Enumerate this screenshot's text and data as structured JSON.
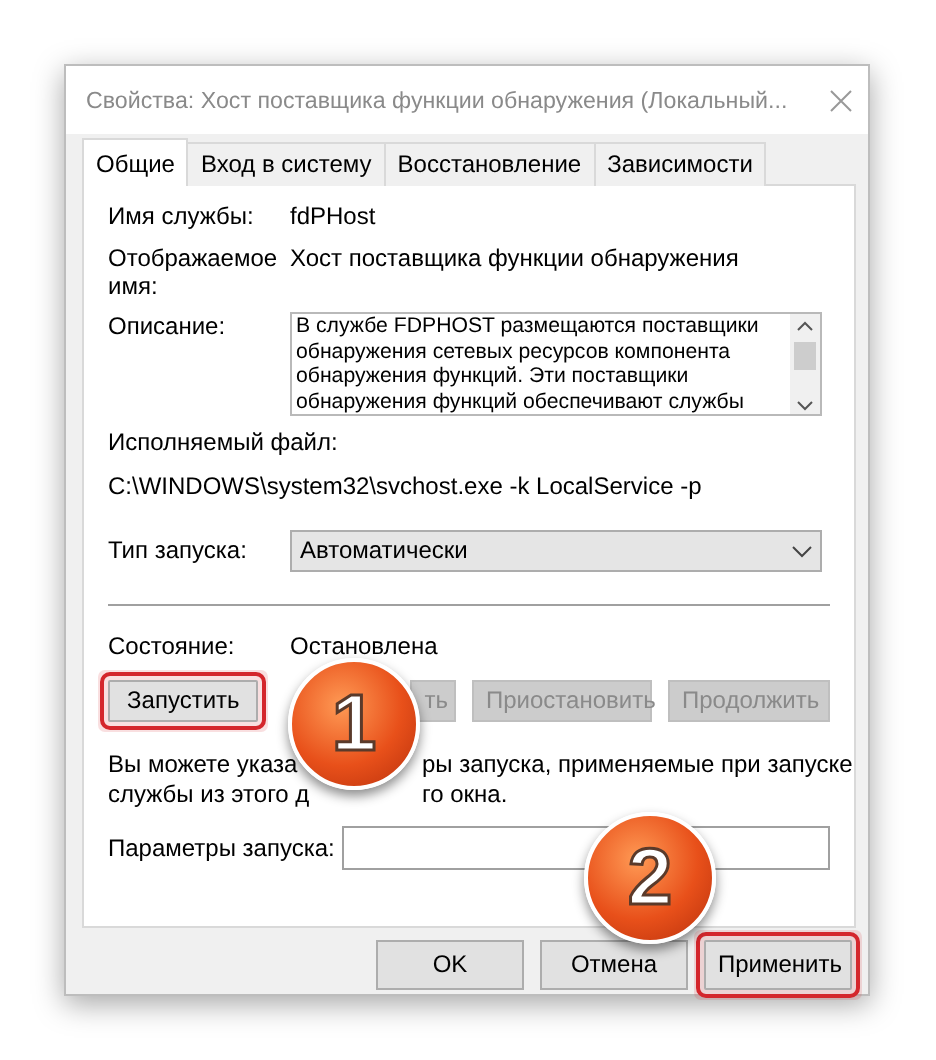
{
  "window": {
    "title": "Свойства: Хост поставщика функции обнаружения (Локальный..."
  },
  "tabs": [
    {
      "label": "Общие",
      "selected": true
    },
    {
      "label": "Вход в систему",
      "selected": false
    },
    {
      "label": "Восстановление",
      "selected": false
    },
    {
      "label": "Зависимости",
      "selected": false
    }
  ],
  "fields": [
    {
      "kind": "text",
      "label": "Имя службы:",
      "value": "fdPHost"
    },
    {
      "kind": "text",
      "label": "Отображаемое имя:",
      "value": "Хост поставщика функции обнаружения"
    },
    {
      "kind": "textarea",
      "label": "Описание:",
      "value": "В службе FDPHOST размещаются поставщики обнаружения сетевых ресурсов компонента обнаружения функций. Эти поставщики обнаружения функций обеспечивают службы"
    }
  ],
  "executable": {
    "label": "Исполняемый файл:",
    "value": "C:\\WINDOWS\\system32\\svchost.exe -k LocalService -p"
  },
  "startup_type": {
    "label": "Тип запуска:",
    "value": "Автоматически"
  },
  "status": {
    "label": "Состояние:",
    "value": "Остановлена"
  },
  "service_buttons": [
    {
      "label": "Запустить",
      "disabled": false,
      "highlighted": true
    },
    {
      "label": "ть",
      "disabled": true,
      "highlighted": false
    },
    {
      "label": "Приостановить",
      "disabled": true,
      "highlighted": false
    },
    {
      "label": "Продолжить",
      "disabled": true,
      "highlighted": false
    }
  ],
  "hint": {
    "lines": [
      [
        "Вы можете указа",
        "ры запуска, применяемые при запуске"
      ],
      [
        "службы из этого д",
        "го окна."
      ]
    ]
  },
  "parameters": {
    "label": "Параметры запуска:"
  },
  "dialog_buttons": [
    {
      "label": "OK",
      "highlighted": false
    },
    {
      "label": "Отмена",
      "highlighted": false
    },
    {
      "label": "Применить",
      "highlighted": true
    }
  ],
  "annotations": [
    {
      "label": "1"
    },
    {
      "label": "2"
    }
  ]
}
